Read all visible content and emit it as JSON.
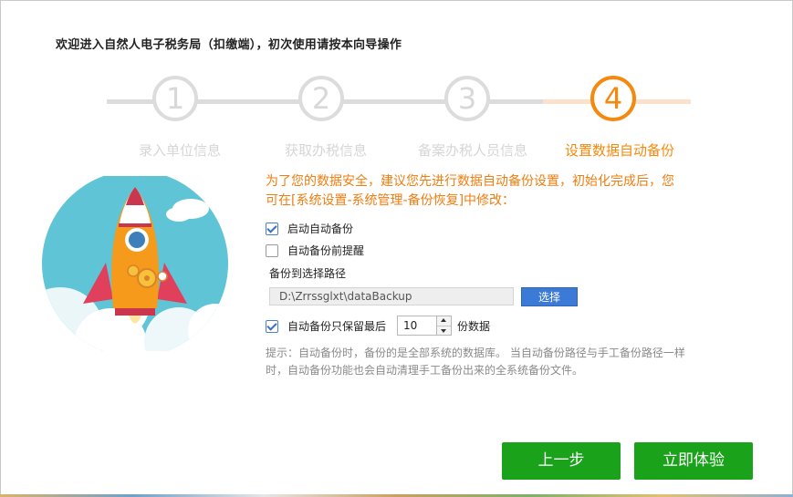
{
  "wizard": {
    "title": "欢迎进入自然人电子税务局（扣缴端），初次使用请按本向导操作",
    "current_step": 4,
    "steps": [
      {
        "number": "1",
        "label": "录入单位信息"
      },
      {
        "number": "2",
        "label": "获取办税信息"
      },
      {
        "number": "3",
        "label": "备案办税人员信息"
      },
      {
        "number": "4",
        "label": "设置数据自动备份"
      }
    ]
  },
  "backup": {
    "notice": "为了您的数据安全，建议您先进行数据自动备份设置，初始化完成后，您可在[系统设置-系统管理-备份恢复]中修改：",
    "auto_backup": {
      "label": "启动自动备份",
      "checked": true
    },
    "remind_before": {
      "label": "自动备份前提醒",
      "checked": false
    },
    "path_label": "备份到选择路径",
    "path_value": "D:\\Zrrssglxt\\dataBackup",
    "select_button": "选择",
    "keep_last": {
      "label": "自动备份只保留最后",
      "checked": true,
      "value": "10",
      "suffix": "份数据"
    },
    "hint": "提示：自动备份时，备份的是全部系统的数据库。 当自动备份路径与手工备份路径一样时，自动备份功能也会自动清理手工备份出来的全系统备份文件。"
  },
  "buttons": {
    "prev": "上一步",
    "start": "立即体验"
  },
  "colors": {
    "accent_orange": "#f5890c",
    "inactive_gray": "#d8d8d8",
    "button_green": "#1aa31a",
    "select_blue": "#3c7ad8"
  }
}
